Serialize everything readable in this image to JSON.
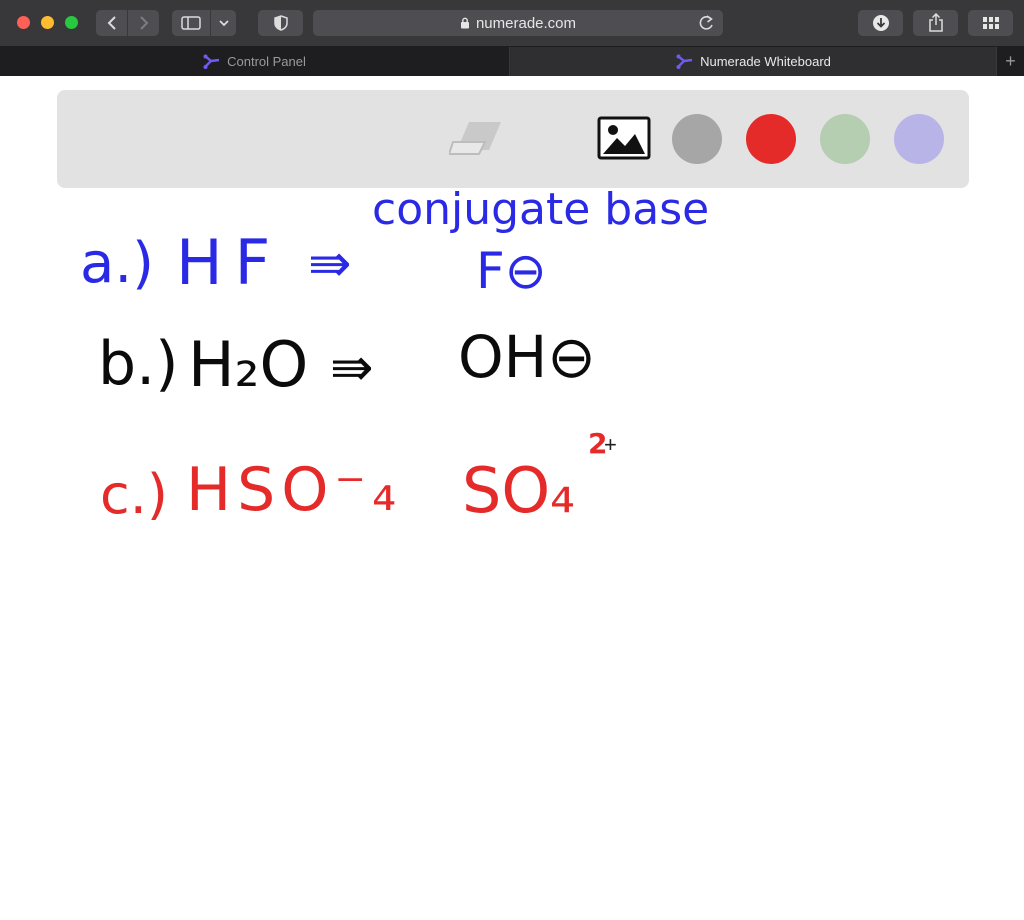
{
  "browser": {
    "url": "numerade.com",
    "tabs": [
      {
        "label": "Control Panel",
        "active": false
      },
      {
        "label": "Numerade Whiteboard",
        "active": true
      }
    ],
    "new_tab_label": "+"
  },
  "toolbar": {
    "tools": [
      "eraser-icon",
      "image-icon"
    ],
    "colors": [
      "#a6a6a6",
      "#e52a2a",
      "#b5cdb0",
      "#b8b4e8"
    ]
  },
  "board": {
    "header": "conjugate base",
    "rows": [
      {
        "label": "a.)",
        "acid": "HF",
        "arrow": "⇛",
        "base": "F⊖",
        "color": "#2a2ae6"
      },
      {
        "label": "b.)",
        "acid": "H₂O",
        "arrow": "⇛",
        "base": "OH⊖",
        "color": "#0b0b0b"
      },
      {
        "label": "c.)",
        "acid": "HSO⁻₄",
        "arrow": "",
        "base": "SO₄",
        "base_superscript": "2",
        "color": "#e52a2a"
      }
    ]
  }
}
